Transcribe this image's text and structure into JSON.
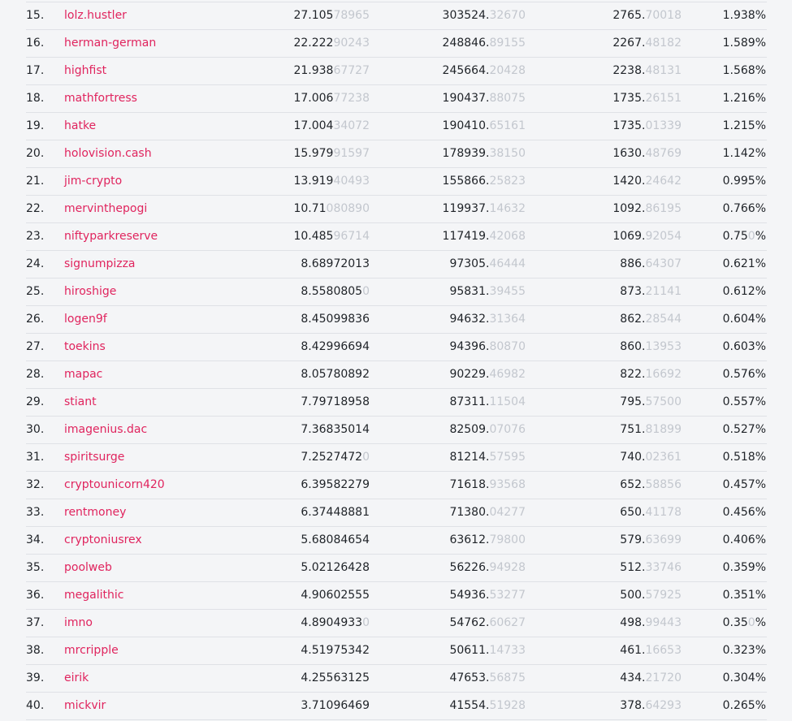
{
  "rows": [
    {
      "rank": "15.",
      "name": "lolz.hustler",
      "v1": [
        "27.105",
        "78965"
      ],
      "v2": [
        "303524.",
        "32670"
      ],
      "v3": [
        "2765.",
        "70018"
      ],
      "pct": [
        "1.938%",
        ""
      ]
    },
    {
      "rank": "16.",
      "name": "herman-german",
      "v1": [
        "22.222",
        "90243"
      ],
      "v2": [
        "248846.",
        "89155"
      ],
      "v3": [
        "2267.",
        "48182"
      ],
      "pct": [
        "1.589%",
        ""
      ]
    },
    {
      "rank": "17.",
      "name": "highfist",
      "v1": [
        "21.938",
        "67727"
      ],
      "v2": [
        "245664.",
        "20428"
      ],
      "v3": [
        "2238.",
        "48131"
      ],
      "pct": [
        "1.568%",
        ""
      ]
    },
    {
      "rank": "18.",
      "name": "mathfortress",
      "v1": [
        "17.006",
        "77238"
      ],
      "v2": [
        "190437.",
        "88075"
      ],
      "v3": [
        "1735.",
        "26151"
      ],
      "pct": [
        "1.216%",
        ""
      ]
    },
    {
      "rank": "19.",
      "name": "hatke",
      "v1": [
        "17.004",
        "34072"
      ],
      "v2": [
        "190410.",
        "65161"
      ],
      "v3": [
        "1735.",
        "01339"
      ],
      "pct": [
        "1.215%",
        ""
      ]
    },
    {
      "rank": "20.",
      "name": "holovision.cash",
      "v1": [
        "15.979",
        "91597"
      ],
      "v2": [
        "178939.",
        "38150"
      ],
      "v3": [
        "1630.",
        "48769"
      ],
      "pct": [
        "1.142%",
        ""
      ]
    },
    {
      "rank": "21.",
      "name": "jim-crypto",
      "v1": [
        "13.919",
        "40493"
      ],
      "v2": [
        "155866.",
        "25823"
      ],
      "v3": [
        "1420.",
        "24642"
      ],
      "pct": [
        "0.995%",
        ""
      ]
    },
    {
      "rank": "22.",
      "name": "mervinthepogi",
      "v1": [
        "10.71",
        "080890"
      ],
      "v2": [
        "119937.",
        "14632"
      ],
      "v3": [
        "1092.",
        "86195"
      ],
      "pct": [
        "0.766%",
        ""
      ]
    },
    {
      "rank": "23.",
      "name": "niftyparkreserve",
      "v1": [
        "10.485",
        "96714"
      ],
      "v2": [
        "117419.",
        "42068"
      ],
      "v3": [
        "1069.",
        "92054"
      ],
      "pct": [
        "0.75",
        "0",
        "%"
      ]
    },
    {
      "rank": "24.",
      "name": "signumpizza",
      "v1": [
        "8.68972013",
        ""
      ],
      "v2": [
        "97305.",
        "46444"
      ],
      "v3": [
        "886.",
        "64307"
      ],
      "pct": [
        "0.621%",
        ""
      ]
    },
    {
      "rank": "25.",
      "name": "hiroshige",
      "v1": [
        "8.5580805",
        "0"
      ],
      "v2": [
        "95831.",
        "39455"
      ],
      "v3": [
        "873.",
        "21141"
      ],
      "pct": [
        "0.612%",
        ""
      ]
    },
    {
      "rank": "26.",
      "name": "logen9f",
      "v1": [
        "8.45099836",
        ""
      ],
      "v2": [
        "94632.",
        "31364"
      ],
      "v3": [
        "862.",
        "28544"
      ],
      "pct": [
        "0.604%",
        ""
      ]
    },
    {
      "rank": "27.",
      "name": "toekins",
      "v1": [
        "8.42996694",
        ""
      ],
      "v2": [
        "94396.",
        "80870"
      ],
      "v3": [
        "860.",
        "13953"
      ],
      "pct": [
        "0.603%",
        ""
      ]
    },
    {
      "rank": "28.",
      "name": "mapac",
      "v1": [
        "8.05780892",
        ""
      ],
      "v2": [
        "90229.",
        "46982"
      ],
      "v3": [
        "822.",
        "16692"
      ],
      "pct": [
        "0.576%",
        ""
      ]
    },
    {
      "rank": "29.",
      "name": "stiant",
      "v1": [
        "7.79718958",
        ""
      ],
      "v2": [
        "87311.",
        "11504"
      ],
      "v3": [
        "795.",
        "57500"
      ],
      "pct": [
        "0.557%",
        ""
      ]
    },
    {
      "rank": "30.",
      "name": "imagenius.dac",
      "v1": [
        "7.36835014",
        ""
      ],
      "v2": [
        "82509.",
        "07076"
      ],
      "v3": [
        "751.",
        "81899"
      ],
      "pct": [
        "0.527%",
        ""
      ]
    },
    {
      "rank": "31.",
      "name": "spiritsurge",
      "v1": [
        "7.2527472",
        "0"
      ],
      "v2": [
        "81214.",
        "57595"
      ],
      "v3": [
        "740.",
        "02361"
      ],
      "pct": [
        "0.518%",
        ""
      ]
    },
    {
      "rank": "32.",
      "name": "cryptounicorn420",
      "v1": [
        "6.39582279",
        ""
      ],
      "v2": [
        "71618.",
        "93568"
      ],
      "v3": [
        "652.",
        "58856"
      ],
      "pct": [
        "0.457%",
        ""
      ]
    },
    {
      "rank": "33.",
      "name": "rentmoney",
      "v1": [
        "6.37448881",
        ""
      ],
      "v2": [
        "71380.",
        "04277"
      ],
      "v3": [
        "650.",
        "41178"
      ],
      "pct": [
        "0.456%",
        ""
      ]
    },
    {
      "rank": "34.",
      "name": "cryptoniusrex",
      "v1": [
        "5.68084654",
        ""
      ],
      "v2": [
        "63612.",
        "79800"
      ],
      "v3": [
        "579.",
        "63699"
      ],
      "pct": [
        "0.406%",
        ""
      ]
    },
    {
      "rank": "35.",
      "name": "poolweb",
      "v1": [
        "5.02126428",
        ""
      ],
      "v2": [
        "56226.",
        "94928"
      ],
      "v3": [
        "512.",
        "33746"
      ],
      "pct": [
        "0.359%",
        ""
      ]
    },
    {
      "rank": "36.",
      "name": "megalithic",
      "v1": [
        "4.90602555",
        ""
      ],
      "v2": [
        "54936.",
        "53277"
      ],
      "v3": [
        "500.",
        "57925"
      ],
      "pct": [
        "0.351%",
        ""
      ]
    },
    {
      "rank": "37.",
      "name": "imno",
      "v1": [
        "4.8904933",
        "0"
      ],
      "v2": [
        "54762.",
        "60627"
      ],
      "v3": [
        "498.",
        "99443"
      ],
      "pct": [
        "0.35",
        "0",
        "%"
      ]
    },
    {
      "rank": "38.",
      "name": "mrcripple",
      "v1": [
        "4.51975342",
        ""
      ],
      "v2": [
        "50611.",
        "14733"
      ],
      "v3": [
        "461.",
        "16653"
      ],
      "pct": [
        "0.323%",
        ""
      ]
    },
    {
      "rank": "39.",
      "name": "eirik",
      "v1": [
        "4.25563125",
        ""
      ],
      "v2": [
        "47653.",
        "56875"
      ],
      "v3": [
        "434.",
        "21720"
      ],
      "pct": [
        "0.304%",
        ""
      ]
    },
    {
      "rank": "40.",
      "name": "mickvir",
      "v1": [
        "3.71096469",
        ""
      ],
      "v2": [
        "41554.",
        "51928"
      ],
      "v3": [
        "378.",
        "64293"
      ],
      "pct": [
        "0.265%",
        ""
      ]
    }
  ]
}
